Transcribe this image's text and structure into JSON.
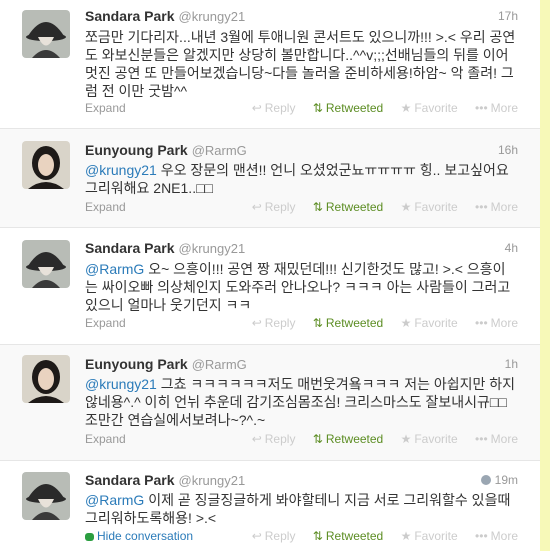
{
  "colors": {
    "background": "#f2f5ac",
    "link": "#2b7bb9",
    "retweeted": "#5c8d23",
    "muted": "#999999"
  },
  "actions": {
    "reply": "Reply",
    "retweeted": "Retweeted",
    "favorite": "Favorite",
    "more": "More",
    "expand": "Expand",
    "hide": "Hide conversation"
  },
  "icons": {
    "reply": "reply-icon",
    "retweet": "retweet-icon",
    "favorite": "star-icon",
    "more": "more-dots-icon",
    "globe": "globe-icon",
    "conversation": "conversation-icon"
  },
  "tweets": [
    {
      "name": "Sandara Park",
      "handle": "@krungy21",
      "time": "17h",
      "mention": "",
      "text": "쪼금만 기다리자...내년 3월에 투애니원 콘서트도 있으니까!!! >.< 우리 공연도 와보신분들은 알겠지만 상당히 볼만합니다..^^v;;;선배님들의 뒤를 이어 멋진 공연 또 만들어보겠습니당~다들 놀러올 준비하세용!하암~ 악 졸려! 그럼 전 이만 굿밤^^"
    },
    {
      "name": "Eunyoung Park",
      "handle": "@RarmG",
      "time": "16h",
      "mention": "@krungy21",
      "text": " 우오 장문의 맨션!! 언니 오셨었군뇨ㅠㅠㅠㅠ 힝.. 보고싶어요 그리워해요 2NE1..□□"
    },
    {
      "name": "Sandara Park",
      "handle": "@krungy21",
      "time": "4h",
      "mention": "@RarmG",
      "text": " 오~ 으흥이!!! 공연 짱 재밌던데!!! 신기한것도 많고! >.< 으흥이는 싸이오빠 의상체인지 도와주러 안나오나? ㅋㅋㅋ 아는 사람들이 그러고있으니 얼마나 웃기던지 ㅋㅋ"
    },
    {
      "name": "Eunyoung Park",
      "handle": "@RarmG",
      "time": "1h",
      "mention": "@krungy21",
      "text": " 그쵸 ㅋㅋㅋㅋㅋㅋ저도 매번웃겨욬ㅋㅋㅋ 저는 아쉽지만 하지 않네용^.^ 이히 언뉘 추운데 감기조심몸조심! 크리스마스도 잘보내시규□□ 조만간 연습실에서보려나~?^.~"
    },
    {
      "name": "Sandara Park",
      "handle": "@krungy21",
      "time": "19m",
      "mention": "@RarmG",
      "text": " 이제 곧 징글징글하게 봐야할테니 지금 서로 그리워할수 있을때 그리워하도록해용! >.<"
    }
  ]
}
